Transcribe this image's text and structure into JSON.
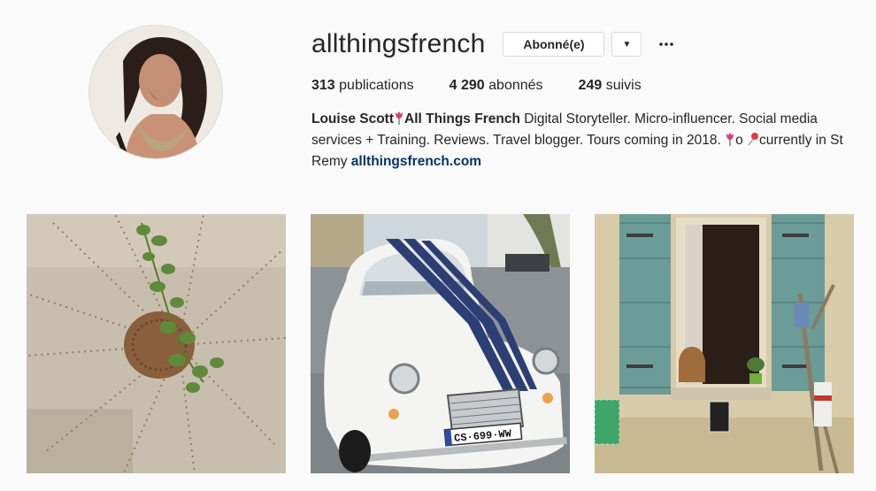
{
  "profile": {
    "username": "allthingsfrench",
    "following_button": "Abonné(e)",
    "dropdown_icon": "caret-down-icon",
    "more_icon": "more-horizontal-icon",
    "stats": {
      "posts_count": "313",
      "posts_label": "publications",
      "followers_count": "4 290",
      "followers_label": "abonnés",
      "following_count": "249",
      "following_label": "suivis"
    },
    "bio": {
      "name": "Louise Scott",
      "name_2": "All Things French",
      "text_1": " Digital Storyteller. Micro-influencer. Social media services + Training. Reviews. Travel blogger. Tours coming in 2018. ",
      "text_2": "o ",
      "text_3": "currently in St Remy ",
      "link": "allthingsfrench.com"
    }
  },
  "posts": [
    {
      "icon": "post-thumbnail-sun-wall"
    },
    {
      "icon": "post-thumbnail-citroen-2cv"
    },
    {
      "icon": "post-thumbnail-window-shutters"
    }
  ],
  "colors": {
    "background": "#fafafa",
    "link": "#003569",
    "border": "#dbdbdb",
    "shutter": "#6b9c98"
  }
}
